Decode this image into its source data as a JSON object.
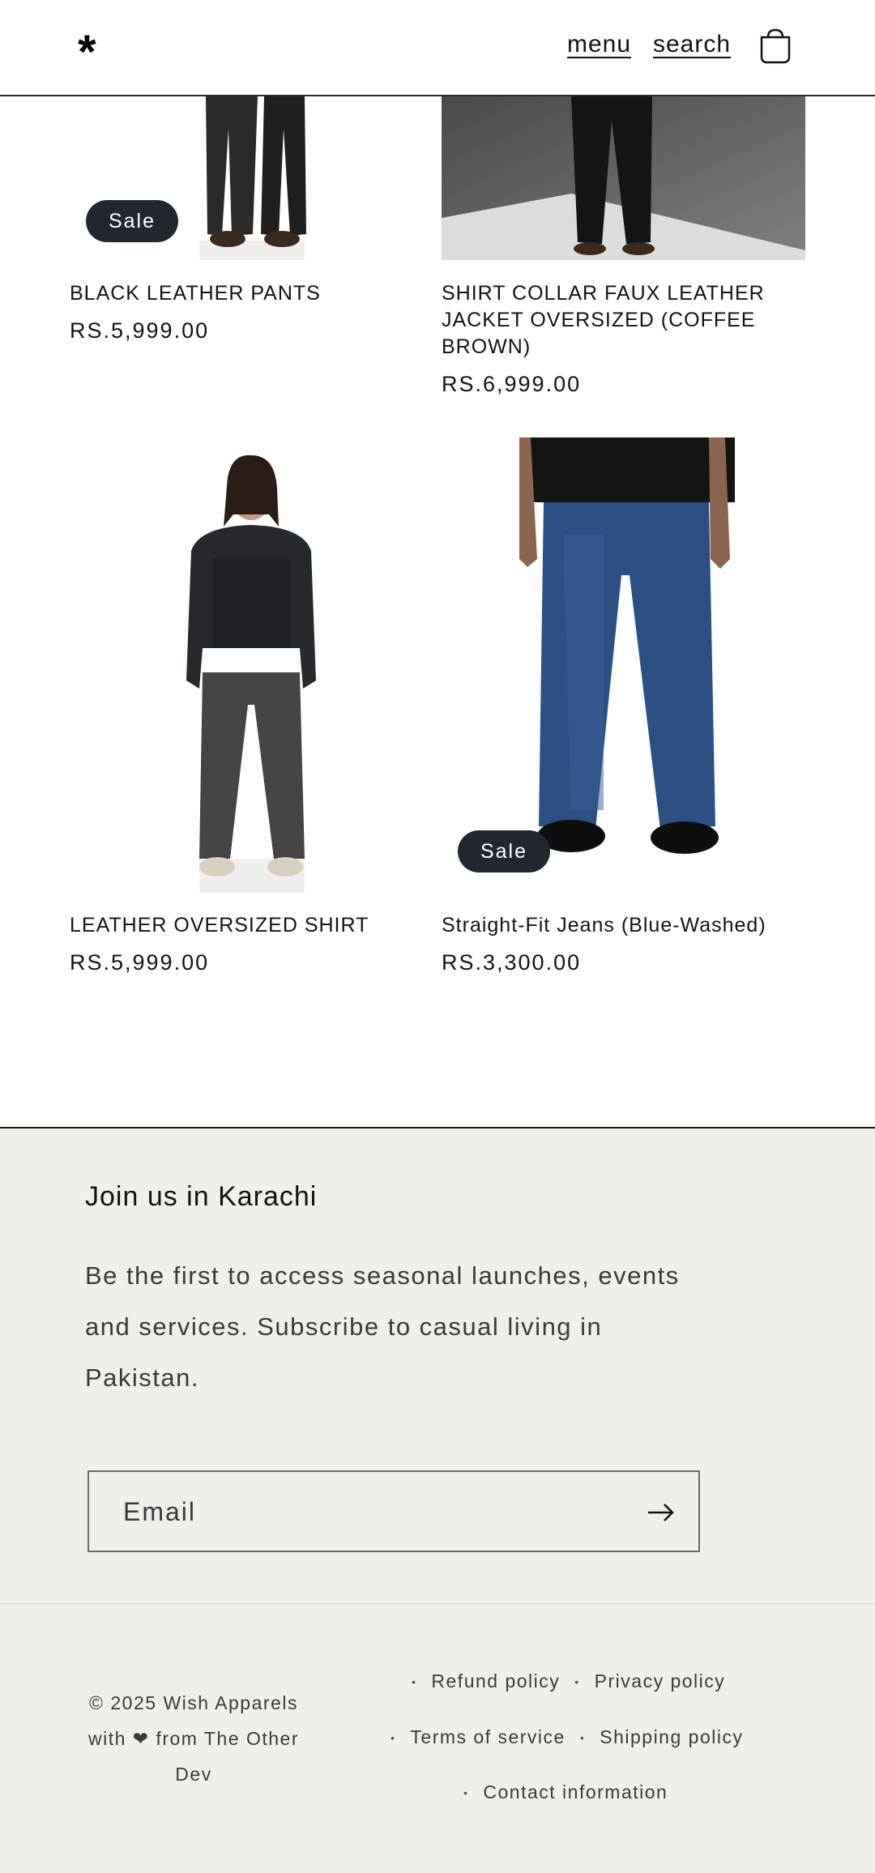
{
  "header": {
    "logo": "*",
    "menu_label": "menu",
    "search_label": "search",
    "cart_icon": "cart-icon"
  },
  "products": [
    {
      "title": "BLACK LEATHER PANTS",
      "price": "RS.5,999.00",
      "badge": "Sale"
    },
    {
      "title": "SHIRT COLLAR FAUX LEATHER JACKET OVERSIZED (COFFEE BROWN)",
      "price": "RS.6,999.00",
      "badge": ""
    },
    {
      "title": "LEATHER OVERSIZED SHIRT",
      "price": "RS.5,999.00",
      "badge": ""
    },
    {
      "title": "Straight-Fit Jeans (Blue-Washed)",
      "price": "RS.3,300.00",
      "badge": "Sale"
    }
  ],
  "newsletter": {
    "heading": "Join us in Karachi",
    "body": "Be the first to access seasonal launches, events and services. Subscribe to casual living in Pakistan.",
    "email_placeholder": "Email",
    "submit_icon": "arrow-right-icon"
  },
  "footer": {
    "copyright": "© 2025 Wish Apparels with ❤ from The Other Dev",
    "links": [
      "Refund policy",
      "Privacy policy",
      "Terms of service",
      "Shipping policy",
      "Contact information"
    ]
  },
  "colors": {
    "badge_bg": "#232730",
    "footer_bg": "#f0f0eb",
    "text": "#121212"
  }
}
